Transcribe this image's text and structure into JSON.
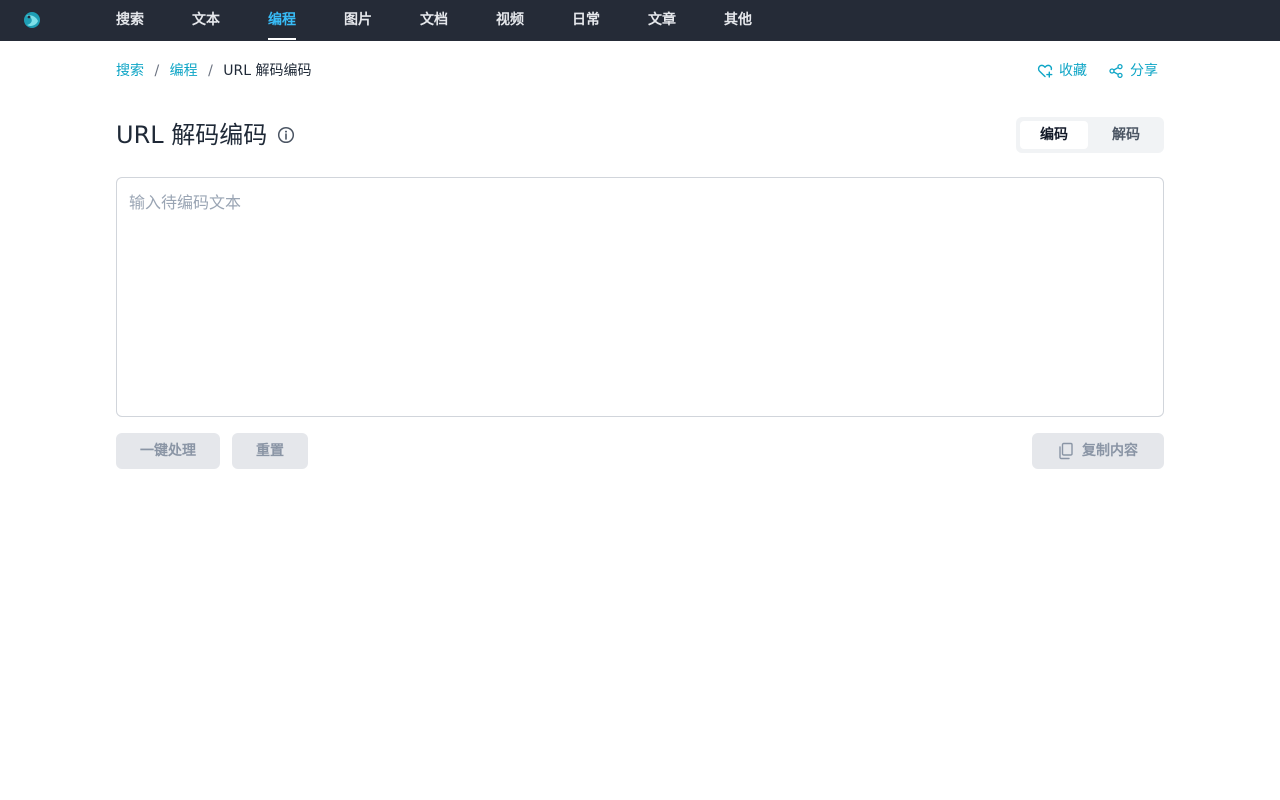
{
  "nav": {
    "logo_icon": "app-logo-icon",
    "items": [
      {
        "label": "搜索",
        "active": false
      },
      {
        "label": "文本",
        "active": false
      },
      {
        "label": "编程",
        "active": true
      },
      {
        "label": "图片",
        "active": false
      },
      {
        "label": "文档",
        "active": false
      },
      {
        "label": "视频",
        "active": false
      },
      {
        "label": "日常",
        "active": false
      },
      {
        "label": "文章",
        "active": false
      },
      {
        "label": "其他",
        "active": false
      }
    ]
  },
  "breadcrumb": {
    "items": [
      "搜索",
      "编程",
      "URL 解码编码"
    ],
    "separator": "/"
  },
  "actions": {
    "favorite_label": "收藏",
    "favorite_icon": "heart-plus-icon",
    "share_label": "分享",
    "share_icon": "share-icon"
  },
  "page": {
    "title": "URL 解码编码",
    "info_icon": "info-icon"
  },
  "mode": {
    "options": [
      "编码",
      "解码"
    ],
    "selected": "编码"
  },
  "input": {
    "value": "",
    "placeholder": "输入待编码文本"
  },
  "buttons": {
    "process_label": "一键处理",
    "reset_label": "重置",
    "copy_label": "复制内容",
    "copy_icon": "copy-icon"
  },
  "colors": {
    "nav_bg": "#252b37",
    "accent": "#0ea5c6",
    "nav_active": "#38bdf8"
  }
}
